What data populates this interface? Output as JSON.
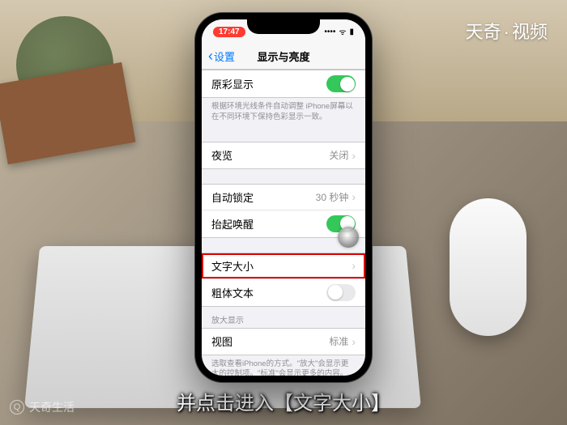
{
  "brand": {
    "name": "天奇",
    "sep": "·",
    "suffix": "视频"
  },
  "watermark": {
    "text": "天奇生活",
    "icon": "Q"
  },
  "caption": "并点击进入【文字大小】",
  "status": {
    "time": "17:47",
    "signal": "••••",
    "wifi": "ᯤ",
    "battery": "▮"
  },
  "nav": {
    "back_icon": "‹",
    "back": "设置",
    "title": "显示与亮度"
  },
  "rows": {
    "true_tone": {
      "label": "原彩显示"
    },
    "true_tone_footer": "根据环境光线条件自动调整 iPhone屏幕以在不同环境下保持色彩显示一致。",
    "night_shift": {
      "label": "夜览",
      "value": "关闭"
    },
    "auto_lock": {
      "label": "自动锁定",
      "value": "30 秒钟"
    },
    "raise_wake": {
      "label": "抬起唤醒"
    },
    "text_size": {
      "label": "文字大小"
    },
    "bold_text": {
      "label": "粗体文本"
    },
    "zoom_header": "放大显示",
    "view": {
      "label": "视图",
      "value": "标准"
    },
    "view_footer": "选取查看iPhone的方式。\"放大\"会显示更大的控制项。\"标准\"会显示更多的内容。"
  },
  "chevron": "›"
}
